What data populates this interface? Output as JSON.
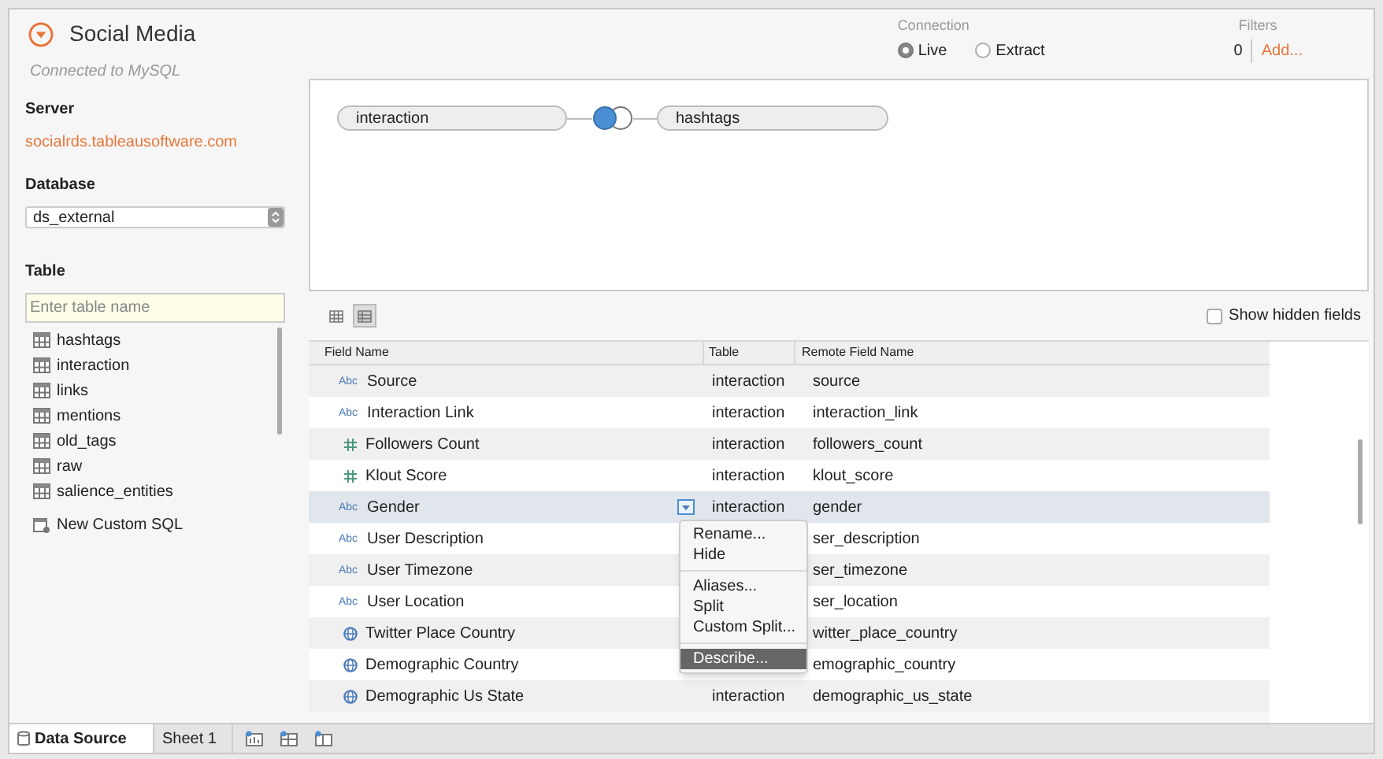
{
  "header": {
    "title": "Social Media",
    "subtitle": "Connected to MySQL"
  },
  "connection": {
    "label": "Connection",
    "options": [
      {
        "label": "Live",
        "selected": true
      },
      {
        "label": "Extract",
        "selected": false
      }
    ]
  },
  "filters": {
    "label": "Filters",
    "count": "0",
    "add": "Add..."
  },
  "sidebar": {
    "server_label": "Server",
    "server": "socialrds.tableausoftware.com",
    "database_label": "Database",
    "database": "ds_external",
    "table_label": "Table",
    "search": {
      "placeholder": "Enter table name"
    },
    "tables": [
      "hashtags",
      "interaction",
      "links",
      "mentions",
      "old_tags",
      "raw",
      "salience_entities"
    ],
    "custom_sql": "New Custom SQL"
  },
  "join": {
    "left": "interaction",
    "right": "hashtags"
  },
  "toolbar": {
    "views": [
      {
        "kind": "grid",
        "selected": false
      },
      {
        "kind": "list",
        "selected": true
      }
    ],
    "show_hidden": {
      "label": "Show hidden fields",
      "checked": false
    }
  },
  "table": {
    "columns": [
      "Field Name",
      "Table",
      "Remote Field Name"
    ],
    "rows": [
      {
        "kind": "text",
        "icon_text": "Abc",
        "name": "Source",
        "table": "interaction",
        "remote": "source",
        "selected": false
      },
      {
        "kind": "text",
        "icon_text": "Abc",
        "name": "Interaction Link",
        "table": "interaction",
        "remote": "interaction_link",
        "selected": false
      },
      {
        "kind": "number",
        "name": "Followers Count",
        "table": "interaction",
        "remote": "followers_count",
        "selected": false
      },
      {
        "kind": "number",
        "name": "Klout Score",
        "table": "interaction",
        "remote": "klout_score",
        "selected": false
      },
      {
        "kind": "text",
        "icon_text": "Abc",
        "name": "Gender",
        "table": "interaction",
        "remote": "gender",
        "selected": true
      },
      {
        "kind": "text",
        "icon_text": "Abc",
        "name": "User Description",
        "remote": "ser_description",
        "selected": false
      },
      {
        "kind": "text",
        "icon_text": "Abc",
        "name": "User Timezone",
        "remote": "ser_timezone",
        "selected": false
      },
      {
        "kind": "text",
        "icon_text": "Abc",
        "name": "User Location",
        "remote": "ser_location",
        "selected": false
      },
      {
        "kind": "geo",
        "name": "Twitter Place Country",
        "remote": "witter_place_country",
        "selected": false
      },
      {
        "kind": "geo",
        "name": "Demographic Country",
        "remote": "emographic_country",
        "selected": false
      },
      {
        "kind": "geo",
        "name": "Demographic Us State",
        "table": "interaction",
        "remote": "demographic_us_state",
        "selected": false
      }
    ]
  },
  "menu": {
    "groups": [
      [
        {
          "label": "Rename...",
          "selected": false
        },
        {
          "label": "Hide",
          "selected": false
        }
      ],
      [
        {
          "label": "Aliases...",
          "selected": false
        },
        {
          "label": "Split",
          "selected": false
        },
        {
          "label": "Custom Split...",
          "selected": false
        }
      ],
      [
        {
          "label": "Describe...",
          "selected": true
        }
      ]
    ]
  },
  "tabs": [
    {
      "label": "Data Source",
      "selected": true
    },
    {
      "label": "Sheet 1",
      "selected": false
    }
  ]
}
